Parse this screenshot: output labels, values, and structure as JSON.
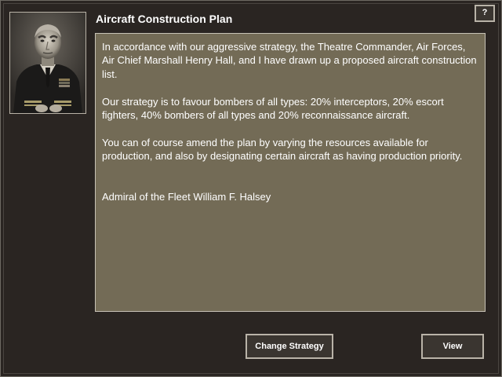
{
  "dialog": {
    "title": "Aircraft Construction Plan",
    "help_label": "?"
  },
  "message": {
    "paragraphs": [
      "In accordance with our aggressive strategy, the Theatre Commander, Air Forces, Air Chief Marshall Henry Hall, and I have drawn up a proposed aircraft construction list.",
      "Our strategy is to favour bombers of all types: 20% interceptors, 20% escort fighters, 40% bombers of all types and 20% reconnaissance aircraft.",
      "You can of course amend the plan by varying the resources available for production, and also by designating certain aircraft as having production priority."
    ],
    "signature": "Admiral of the Fleet William F. Halsey"
  },
  "buttons": {
    "change_strategy": "Change Strategy",
    "view": "View"
  },
  "colors": {
    "background": "#2a2522",
    "panel": "#736b56",
    "text": "#ffffff"
  }
}
